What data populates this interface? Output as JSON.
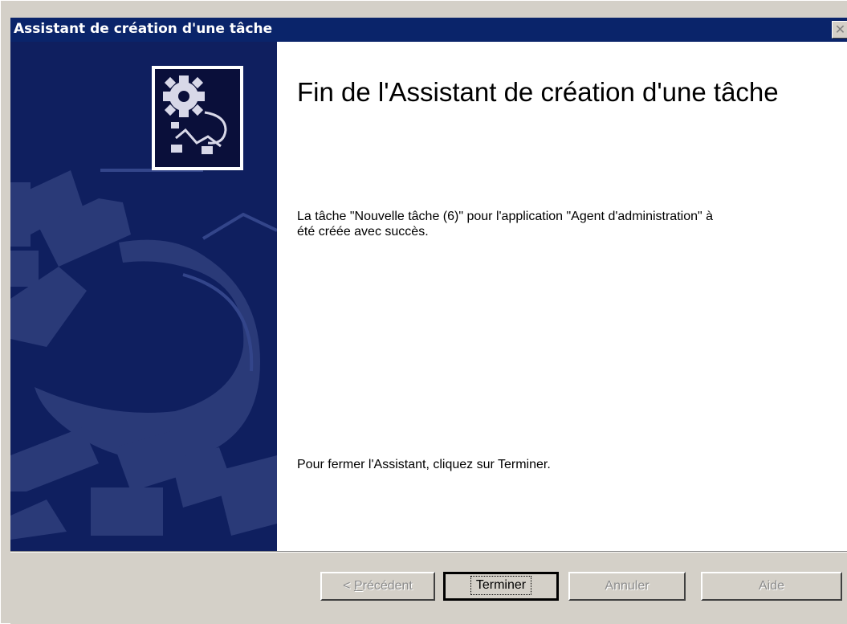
{
  "window": {
    "title": "Assistant de création d'une tâche",
    "close_glyph": "✕"
  },
  "main": {
    "heading": "Fin de l'Assistant de création d'une tâche",
    "message": "La tâche \"Nouvelle tâche (6)\" pour l'application \"Agent d'administration\" à été créée avec succès.",
    "close_hint": "Pour fermer l'Assistant, cliquez sur Terminer."
  },
  "buttons": {
    "prev_prefix": "< ",
    "prev_mnemonic": "P",
    "prev_rest": "récédent",
    "finish": "Terminer",
    "cancel": "Annuler",
    "help": "Aide"
  },
  "icons": {
    "banner": "gear-chevron-graphic",
    "wizard": "wizard-gear-icon",
    "close": "close-icon"
  },
  "colors": {
    "titlebar": "#0a246a",
    "banner": "#0f1f5f",
    "dialog": "#d4d0c8"
  }
}
